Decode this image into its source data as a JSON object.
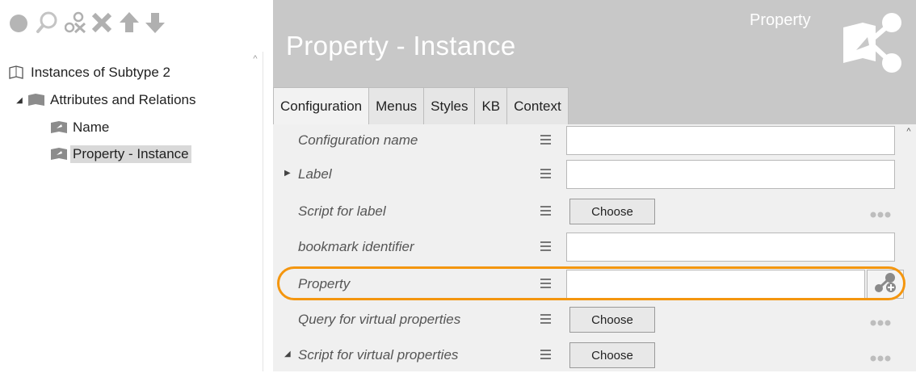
{
  "tree": {
    "root": {
      "label": "Instances of Subtype 2",
      "icon": "open-book-icon"
    },
    "group": {
      "label": "Attributes and Relations",
      "icon": "folder-book-icon",
      "expanded": true
    },
    "items": [
      {
        "label": "Name",
        "icon": "attribute-icon",
        "selected": false
      },
      {
        "label": "Property - Instance",
        "icon": "attribute-icon",
        "selected": true
      }
    ]
  },
  "toolbar": {
    "icons": [
      "circle-icon",
      "search-icon",
      "key-remove-icon",
      "delete-icon",
      "arrow-up-icon",
      "arrow-down-icon"
    ]
  },
  "header": {
    "title": "Property - Instance",
    "type_label": "Property",
    "logo_icon": "property-relation-icon",
    "background": "#c8c8c8"
  },
  "tabs": [
    {
      "label": "Configuration",
      "active": true
    },
    {
      "label": "Menus",
      "active": false
    },
    {
      "label": "Styles",
      "active": false
    },
    {
      "label": "KB",
      "active": false
    },
    {
      "label": "Context",
      "active": false
    }
  ],
  "form": {
    "rows": [
      {
        "label": "Configuration name",
        "control": "text",
        "value": ""
      },
      {
        "label": "Label",
        "control": "text",
        "value": "",
        "expandable": "collapsed"
      },
      {
        "label": "Script for label",
        "control": "choose",
        "button": "Choose"
      },
      {
        "label": "bookmark identifier",
        "control": "text",
        "value": ""
      },
      {
        "label": "Property",
        "control": "relation",
        "value": "",
        "highlighted": true
      },
      {
        "label": "Query for virtual properties",
        "control": "choose",
        "button": "Choose"
      },
      {
        "label": "Script for virtual properties",
        "control": "choose",
        "button": "Choose",
        "expandable": "expanded"
      }
    ]
  },
  "colors": {
    "highlight": "#f4960f",
    "header": "#c8c8c8",
    "form_background": "#f0f0f0"
  }
}
